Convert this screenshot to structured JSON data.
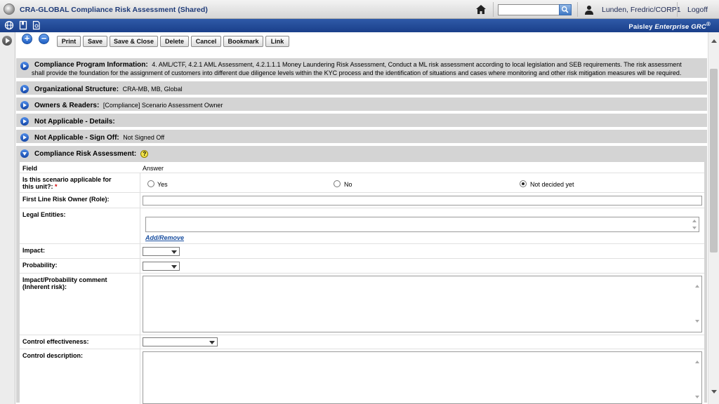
{
  "window": {
    "title": "CRA-GLOBAL Compliance Risk Assessment (Shared)",
    "user": "Lunden, Fredric/CORP1",
    "logoff": "Logoff",
    "search_value": "",
    "brand_plain": "Paisley ",
    "brand_italic": "Enterprise GRC",
    "brand_mark": "®"
  },
  "toolbar": {
    "add_symbol": "+",
    "remove_symbol": "−",
    "print": "Print",
    "save": "Save",
    "save_close": "Save & Close",
    "delete": "Delete",
    "cancel": "Cancel",
    "bookmark": "Bookmark",
    "link": "Link"
  },
  "sections": {
    "program_info": {
      "title": "Compliance Program Information",
      "value_line1": "4. AML/CTF, 4.2.1 AML Assessment, 4.2.1.1.1 Money Laundering Risk Assessment, Conduct a ML risk assessment according to local legislation and SEB requirements. The risk assessment",
      "value_line2": "shall provide the foundation for the assignment of customers into different due diligence levels within the KYC process and the identification of situations and cases where monitoring and other risk mitigation measures will be required."
    },
    "org_structure": {
      "title": "Organizational Structure",
      "value": "CRA-MB, MB, Global"
    },
    "owners_readers": {
      "title": "Owners & Readers",
      "value": "[Compliance] Scenario Assessment Owner"
    },
    "na_details": {
      "title": "Not Applicable - Details",
      "value": ""
    },
    "na_signoff": {
      "title": "Not Applicable - Sign Off",
      "value": "Not Signed Off"
    },
    "cra": {
      "title": "Compliance Risk Assessment",
      "help": "?"
    }
  },
  "form": {
    "col_field": "Field",
    "col_answer": "Answer",
    "applicable": {
      "label_line1": "Is this scenario applicable for",
      "label_line2": "this unit?:",
      "required_mark": "*",
      "options": [
        "Yes",
        "No",
        "Not decided yet"
      ],
      "selected": "Not decided yet"
    },
    "first_line_owner": {
      "label": "First Line Risk Owner (Role):",
      "value": ""
    },
    "legal_entities": {
      "label": "Legal Entities:",
      "value": "",
      "add_remove": "Add/Remove"
    },
    "impact": {
      "label": "Impact:",
      "value": ""
    },
    "probability": {
      "label": "Probability:",
      "value": ""
    },
    "impact_prob_comment": {
      "label_line1": "Impact/Probability comment",
      "label_line2": "(Inherent risk):",
      "value": ""
    },
    "control_effectiveness": {
      "label": "Control effectiveness:",
      "value": ""
    },
    "control_description": {
      "label": "Control description:",
      "value": ""
    }
  }
}
